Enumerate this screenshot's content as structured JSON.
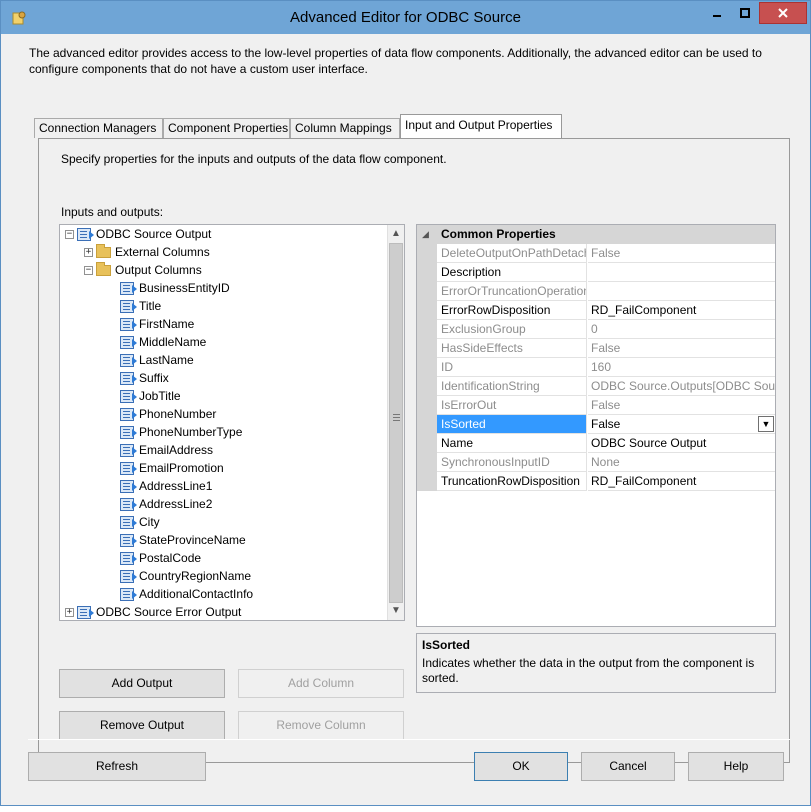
{
  "window": {
    "title": "Advanced Editor for ODBC Source"
  },
  "intro": "The advanced editor provides access to the low-level properties of data flow components. Additionally, the advanced editor can be used to configure components that do not have a custom user interface.",
  "tabs": [
    {
      "label": "Connection Managers"
    },
    {
      "label": "Component Properties"
    },
    {
      "label": "Column Mappings"
    },
    {
      "label": "Input and Output Properties",
      "active": true
    }
  ],
  "panel": {
    "description": "Specify properties for the inputs and outputs of the data flow component.",
    "io_label": "Inputs and outputs:"
  },
  "tree": {
    "output": "ODBC Source Output",
    "external_columns": "External Columns",
    "output_columns": "Output Columns",
    "columns": [
      "BusinessEntityID",
      "Title",
      "FirstName",
      "MiddleName",
      "LastName",
      "Suffix",
      "JobTitle",
      "PhoneNumber",
      "PhoneNumberType",
      "EmailAddress",
      "EmailPromotion",
      "AddressLine1",
      "AddressLine2",
      "City",
      "StateProvinceName",
      "PostalCode",
      "CountryRegionName",
      "AdditionalContactInfo"
    ],
    "error_output": "ODBC Source Error Output"
  },
  "properties": {
    "category": "Common Properties",
    "rows": [
      {
        "name": "DeleteOutputOnPathDetach",
        "value": "False",
        "readonly": true
      },
      {
        "name": "Description",
        "value": "",
        "readonly": false
      },
      {
        "name": "ErrorOrTruncationOperation",
        "value": "",
        "readonly": true
      },
      {
        "name": "ErrorRowDisposition",
        "value": "RD_FailComponent",
        "readonly": false
      },
      {
        "name": "ExclusionGroup",
        "value": "0",
        "readonly": true
      },
      {
        "name": "HasSideEffects",
        "value": "False",
        "readonly": true
      },
      {
        "name": "ID",
        "value": "160",
        "readonly": true
      },
      {
        "name": "IdentificationString",
        "value": "ODBC Source.Outputs[ODBC Source Output]",
        "readonly": true
      },
      {
        "name": "IsErrorOut",
        "value": "False",
        "readonly": true
      },
      {
        "name": "IsSorted",
        "value": "False",
        "readonly": false,
        "selected": true
      },
      {
        "name": "Name",
        "value": "ODBC Source Output",
        "readonly": false
      },
      {
        "name": "SynchronousInputID",
        "value": "None",
        "readonly": true
      },
      {
        "name": "TruncationRowDisposition",
        "value": "RD_FailComponent",
        "readonly": false
      }
    ]
  },
  "help": {
    "title": "IsSorted",
    "text": "Indicates whether the data in the output from the component is sorted."
  },
  "buttons": {
    "add_output": "Add Output",
    "add_column": "Add Column",
    "remove_output": "Remove Output",
    "remove_column": "Remove Column",
    "refresh": "Refresh",
    "ok": "OK",
    "cancel": "Cancel",
    "help": "Help"
  }
}
